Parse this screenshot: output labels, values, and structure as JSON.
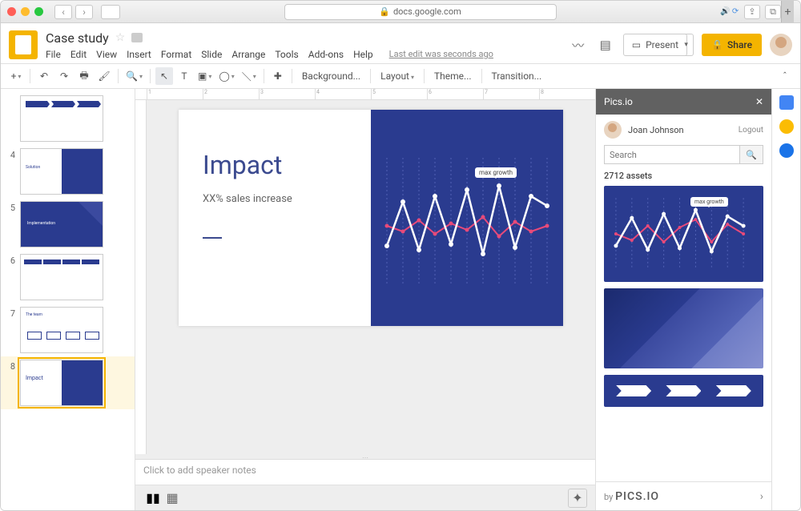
{
  "browser": {
    "url_host": "docs.google.com",
    "lock": "🔒"
  },
  "doc": {
    "title": "Case study",
    "last_edit": "Last edit was seconds ago",
    "menus": [
      "File",
      "Edit",
      "View",
      "Insert",
      "Format",
      "Slide",
      "Arrange",
      "Tools",
      "Add-ons",
      "Help"
    ]
  },
  "header": {
    "present_label": "Present",
    "share_label": "Share"
  },
  "toolbar": {
    "background": "Background...",
    "layout": "Layout",
    "theme": "Theme...",
    "transition": "Transition..."
  },
  "thumbnails": [
    {
      "num": "",
      "kind": "challenges"
    },
    {
      "num": "4",
      "kind": "solution"
    },
    {
      "num": "5",
      "kind": "implementation"
    },
    {
      "num": "6",
      "kind": "timeline"
    },
    {
      "num": "7",
      "kind": "team"
    },
    {
      "num": "8",
      "kind": "impact",
      "active": true
    }
  ],
  "slide": {
    "title": "Impact",
    "subtitle": "XX% sales increase",
    "annotation": "max growth"
  },
  "notes_placeholder": "Click to add speaker notes",
  "sidebar": {
    "title": "Pics.io",
    "user": "Joan Johnson",
    "logout": "Logout",
    "search_placeholder": "Search",
    "count": "2712 assets",
    "brand_prefix": "by",
    "brand": "PICS.IO",
    "asset_annotation": "max growth"
  },
  "chart_data": {
    "type": "line",
    "note": "decorative dual-line chart on blue background; values are approximate relative heights read from the graphic (0-100 scale)",
    "x": [
      1,
      2,
      3,
      4,
      5,
      6,
      7,
      8,
      9,
      10,
      11,
      12
    ],
    "series": [
      {
        "name": "white",
        "color": "#ffffff",
        "values": [
          40,
          72,
          30,
          78,
          35,
          82,
          28,
          85,
          32,
          78,
          30,
          70
        ]
      },
      {
        "name": "pink",
        "color": "#e84a7a",
        "values": [
          55,
          48,
          62,
          45,
          58,
          50,
          66,
          42,
          60,
          48,
          55,
          45
        ]
      }
    ],
    "annotation": {
      "label": "max growth",
      "x": 8
    }
  }
}
